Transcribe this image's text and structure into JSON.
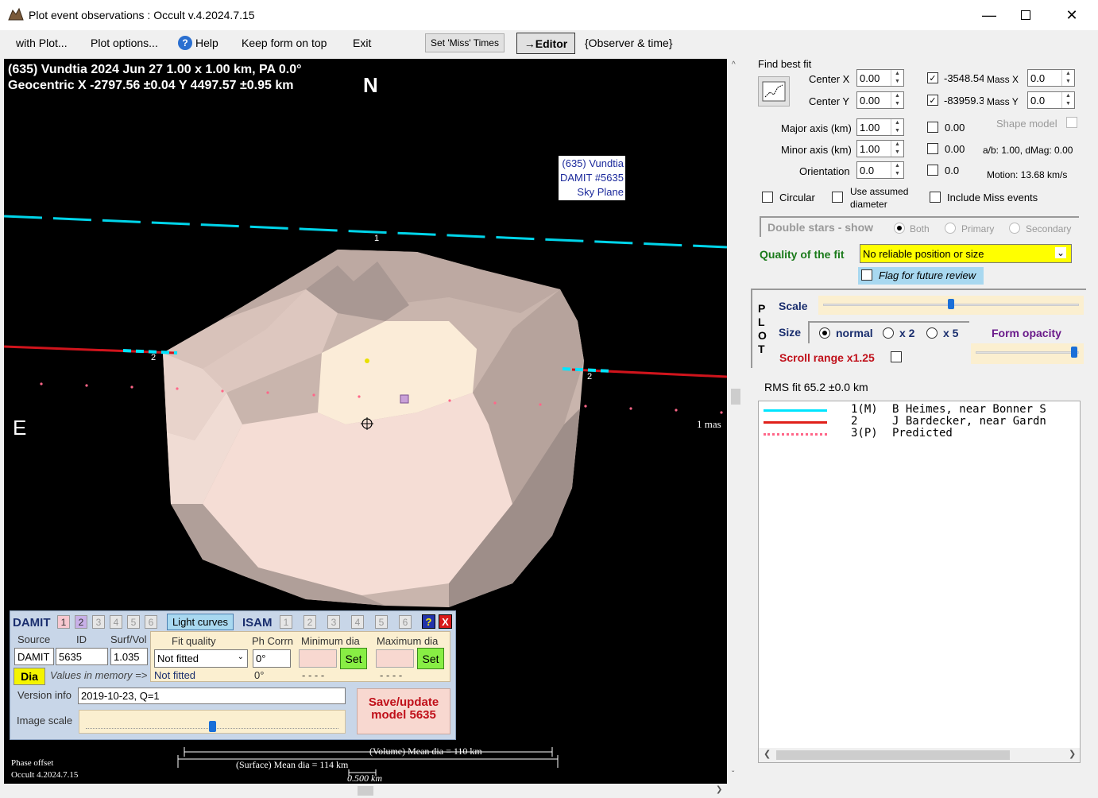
{
  "window": {
    "title": "Plot event observations : Occult v.4.2024.7.15",
    "min_icon": "minimize-icon",
    "max_icon": "maximize-icon",
    "close_icon": "close-icon"
  },
  "menu": {
    "with_plot": "with Plot...",
    "plot_options": "Plot options...",
    "help": "Help",
    "keep_on_top": "Keep form on top",
    "exit": "Exit",
    "set_miss": "Set 'Miss' Times",
    "editor": "→Editor",
    "observer_time": "{Observer & time}"
  },
  "plot": {
    "header1": "(635) Vundtia  2024 Jun 27   1.00 x 1.00 km, PA 0.0°",
    "header2": "Geocentric  X  -2797.56 ±0.04  Y 4497.57 ±0.95 km",
    "north": "N",
    "east": "E",
    "label_name": "(635) Vundtia",
    "label_damit": "DAMIT #5635",
    "label_plane": "Sky Plane",
    "chord1": "1",
    "chord2a": "2",
    "chord2b": "2",
    "scale_mas": "1 mas",
    "phase_offset": "Phase offset",
    "occult_version": "Occult 4.2024.7.15",
    "volume_dia": "(Volume) Mean dia = 110 km",
    "surface_dia": "(Surface) Mean dia = 114 km",
    "scale_km": "0.500 km"
  },
  "damit": {
    "title": "DAMIT",
    "nums": [
      "1",
      "2",
      "3",
      "4",
      "5",
      "6"
    ],
    "light_curves": "Light curves",
    "isam": "ISAM",
    "isam_nums": [
      "1",
      "2",
      "3",
      "4",
      "5",
      "6"
    ],
    "help": "?",
    "close": "X",
    "h_source": "Source",
    "h_id": "ID",
    "h_surf": "Surf/Vol",
    "h_fit": "Fit quality",
    "h_ph": "Ph Corrn",
    "h_min": "Minimum dia",
    "h_max": "Maximum dia",
    "source": "DAMIT",
    "id": "5635",
    "surf": "1.035",
    "fit": "Not fitted",
    "ph": "0°",
    "set1": "Set",
    "set2": "Set",
    "dia": "Dia",
    "values_mem": "Values in memory =>",
    "fit_mem": "Not fitted",
    "ph_mem": "0°",
    "min_mem": "- - - -",
    "max_mem": "- - - -",
    "version_label": "Version info",
    "version": "2019-10-23, Q=1",
    "image_scale": "Image scale",
    "save": "Save/update",
    "save2": "model 5635",
    "image_scale_level": 0.5
  },
  "right": {
    "find_best_fit": "Find best fit",
    "center_x": "Center X",
    "center_y": "Center Y",
    "cx": "0.00",
    "cy": "0.00",
    "cx2": "-3548.54",
    "cy2": "-83959.3",
    "mass_x": "Mass X",
    "mass_y": "Mass Y",
    "mx": "0.0",
    "my": "0.0",
    "major": "Major axis (km)",
    "minor": "Minor axis (km)",
    "orient": "Orientation",
    "major_v": "1.00",
    "minor_v": "1.00",
    "orient_v": "0.0",
    "major_c": "0.00",
    "minor_c": "0.00",
    "orient_c": "0.0",
    "shape_model": "Shape model",
    "ab": "a/b: 1.00, dMag: 0.00",
    "motion": "Motion: 13.68 km/s",
    "circular": "Circular",
    "use_assumed": "Use assumed",
    "diameter": "diameter",
    "include_miss": "Include Miss events",
    "double_stars": "Double stars - show",
    "both": "Both",
    "primary": "Primary",
    "secondary": "Secondary",
    "quality_label": "Quality of the fit",
    "quality": "No reliable position or size",
    "flag": "Flag for future review",
    "plot_letters": "PLOT",
    "scale": "Scale",
    "size": "Size",
    "normal": "normal",
    "x2": "x 2",
    "x5": "x 5",
    "form_opacity": "Form opacity",
    "scroll_range": "Scroll range x1.25",
    "rms": "RMS fit 65.2 ±0.0 km",
    "scale_level": 0.5,
    "opacity_level": 0.95
  },
  "legend": [
    {
      "num": "1(M)",
      "text": "B Heimes, near Bonner S",
      "color": "#00e5ff",
      "style": "solid"
    },
    {
      "num": "2",
      "text": "J Bardecker, near Gardn",
      "color": "#e0201a",
      "style": "solid"
    },
    {
      "num": "3(P)",
      "text": "Predicted",
      "color": "#ff6688",
      "style": "dots"
    }
  ]
}
